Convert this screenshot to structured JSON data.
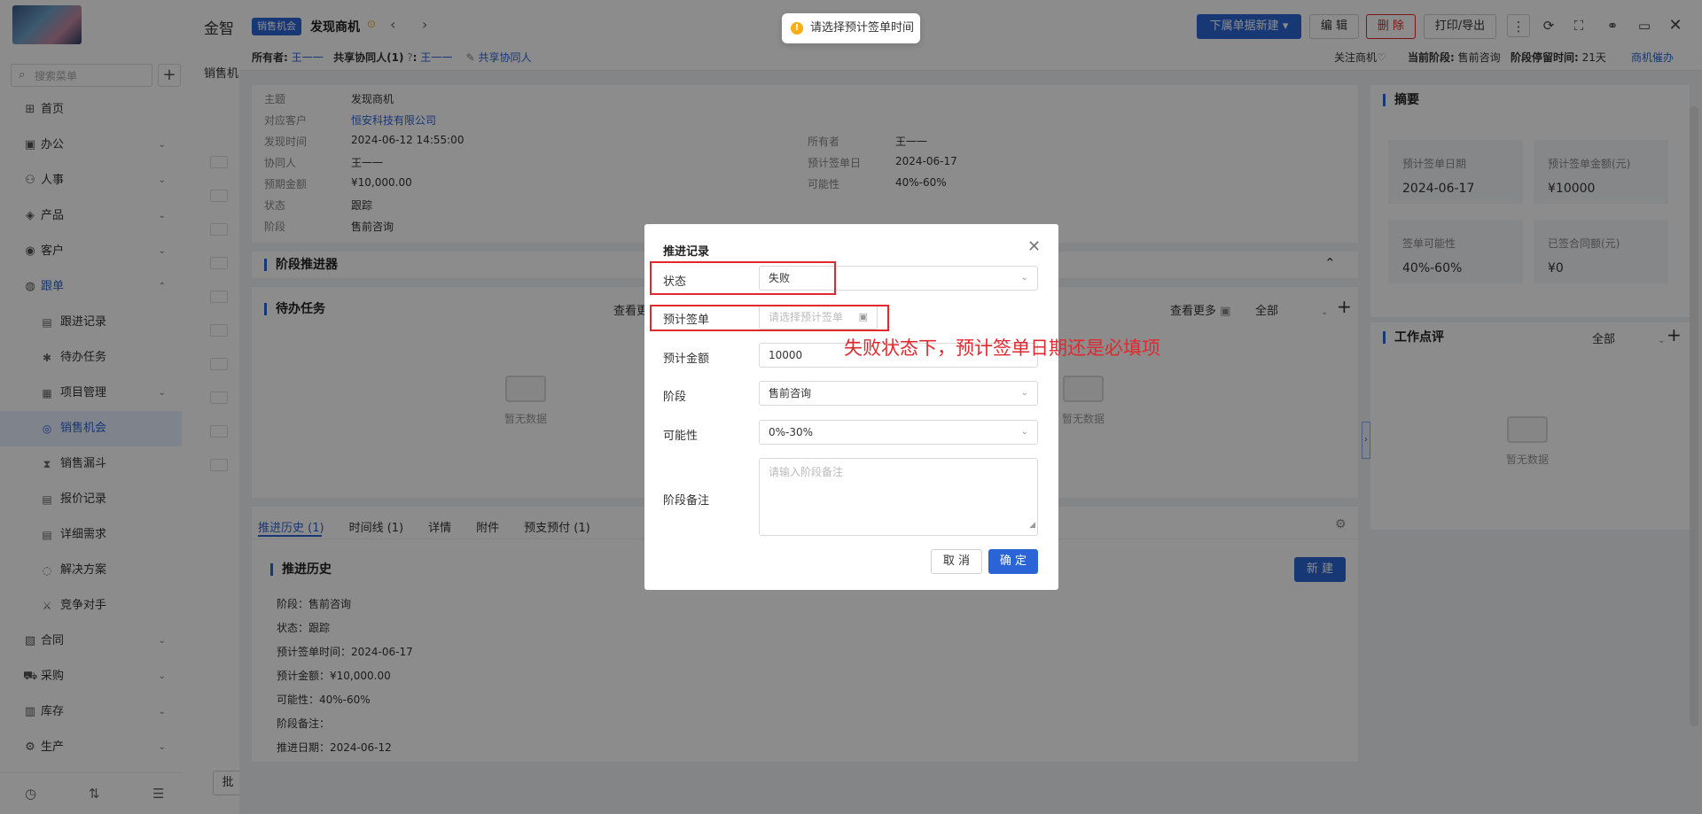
{
  "sidebar": {
    "search_placeholder": "搜索菜单",
    "items": [
      {
        "label": "首页",
        "icon": "home-icon",
        "glyph": "⊞"
      },
      {
        "label": "办公",
        "icon": "office-icon",
        "glyph": "▣"
      },
      {
        "label": "人事",
        "icon": "hr-icon",
        "glyph": "⚇"
      },
      {
        "label": "产品",
        "icon": "product-icon",
        "glyph": "◈"
      },
      {
        "label": "客户",
        "icon": "customer-icon",
        "glyph": "◉"
      },
      {
        "label": "跟单",
        "icon": "followup-icon",
        "glyph": "◍"
      }
    ],
    "sub_items": [
      {
        "label": "跟进记录",
        "icon": "record-icon",
        "glyph": "▤"
      },
      {
        "label": "待办任务",
        "icon": "pin-icon",
        "glyph": "✱"
      },
      {
        "label": "项目管理",
        "icon": "project-icon",
        "glyph": "▦"
      },
      {
        "label": "销售机会",
        "icon": "opportunity-icon",
        "glyph": "◎"
      },
      {
        "label": "销售漏斗",
        "icon": "funnel-icon",
        "glyph": "⧗"
      },
      {
        "label": "报价记录",
        "icon": "quote-icon",
        "glyph": "▤"
      },
      {
        "label": "详细需求",
        "icon": "demand-icon",
        "glyph": "▤"
      },
      {
        "label": "解决方案",
        "icon": "solution-icon",
        "glyph": "◌"
      },
      {
        "label": "竞争对手",
        "icon": "competitor-icon",
        "glyph": "⚔"
      }
    ],
    "bottom_items": [
      {
        "label": "合同",
        "icon": "contract-icon",
        "glyph": "▧"
      },
      {
        "label": "采购",
        "icon": "purchase-icon",
        "glyph": "⛟"
      },
      {
        "label": "库存",
        "icon": "stock-icon",
        "glyph": "▥"
      },
      {
        "label": "生产",
        "icon": "production-icon",
        "glyph": "⚙"
      }
    ]
  },
  "bg": {
    "title": "金智",
    "tab": "销售机",
    "button": "批"
  },
  "header": {
    "tag": "销售机会",
    "title": "发现商机",
    "owner_label": "所有者:",
    "owner": "王一一",
    "share_label": "共享协同人(1)",
    "share_value": "王一一",
    "share_link": "共享协同人",
    "follow_label": "关注商机",
    "stage_label": "当前阶段:",
    "stage_value": "售前咨询",
    "stay_label": "阶段停留时间:",
    "stay_value": "21天",
    "remind": "商机催办",
    "btn_new": "下属单据新建",
    "btn_edit": "编 辑",
    "btn_delete": "删 除",
    "btn_print": "打印/导出"
  },
  "info": {
    "rows_left": [
      {
        "k": "主题",
        "v": "发现商机"
      },
      {
        "k": "对应客户",
        "v": "恒安科技有限公司"
      },
      {
        "k": "发现时间",
        "v": "2024-06-12 14:55:00"
      },
      {
        "k": "协同人",
        "v": "王一一"
      },
      {
        "k": "预期金额",
        "v": "¥10,000.00"
      },
      {
        "k": "状态",
        "v": "跟踪"
      },
      {
        "k": "阶段",
        "v": "售前咨询"
      }
    ],
    "rows_right": [
      {
        "k": "所有者",
        "v": "王一一"
      },
      {
        "k": "预计签单日",
        "v": "2024-06-17"
      },
      {
        "k": "可能性",
        "v": "40%-60%"
      }
    ]
  },
  "advancer": {
    "title": "阶段推进器"
  },
  "todo": {
    "title": "待办任务",
    "more": "查看更",
    "more_right": "查看更多",
    "filter": "全部",
    "empty": "暂无数据"
  },
  "tabs": [
    "推进历史 (1)",
    "时间线 (1)",
    "详情",
    "附件",
    "预支预付 (1)"
  ],
  "history": {
    "title": "推进历史",
    "new_btn": "新 建",
    "lines": [
      "阶段：售前咨询",
      "状态：跟踪",
      "预计签单时间：2024-06-17",
      "预计金额：¥10,000.00",
      "可能性：40%-60%",
      "阶段备注：",
      "推进日期：2024-06-12"
    ]
  },
  "summary": {
    "title": "摘要",
    "boxes": [
      {
        "l": "预计签单日期",
        "v": "2024-06-17"
      },
      {
        "l": "预计签单金额(元)",
        "v": "¥10000"
      },
      {
        "l": "签单可能性",
        "v": "40%-60%"
      },
      {
        "l": "已签合同额(元)",
        "v": "¥0"
      }
    ]
  },
  "review": {
    "title": "工作点评",
    "filter": "全部",
    "empty": "暂无数据"
  },
  "toast": "请选择预计签单时间",
  "modal": {
    "title": "推进记录",
    "status_label": "状态",
    "status_value": "失败",
    "sign_label": "预计签单",
    "sign_placeholder": "请选择预计签单",
    "amount_label": "预计金额",
    "amount_value": "10000",
    "stage_label": "阶段",
    "stage_value": "售前咨询",
    "possibility_label": "可能性",
    "possibility_value": "0%-30%",
    "note_label": "阶段备注",
    "note_placeholder": "请输入阶段备注",
    "cancel": "取 消",
    "ok": "确 定"
  },
  "annotation": "失败状态下，预计签单日期还是必填项",
  "colors": {
    "primary": "#2b64d6",
    "danger": "#e0282f",
    "warning": "#faad14"
  }
}
